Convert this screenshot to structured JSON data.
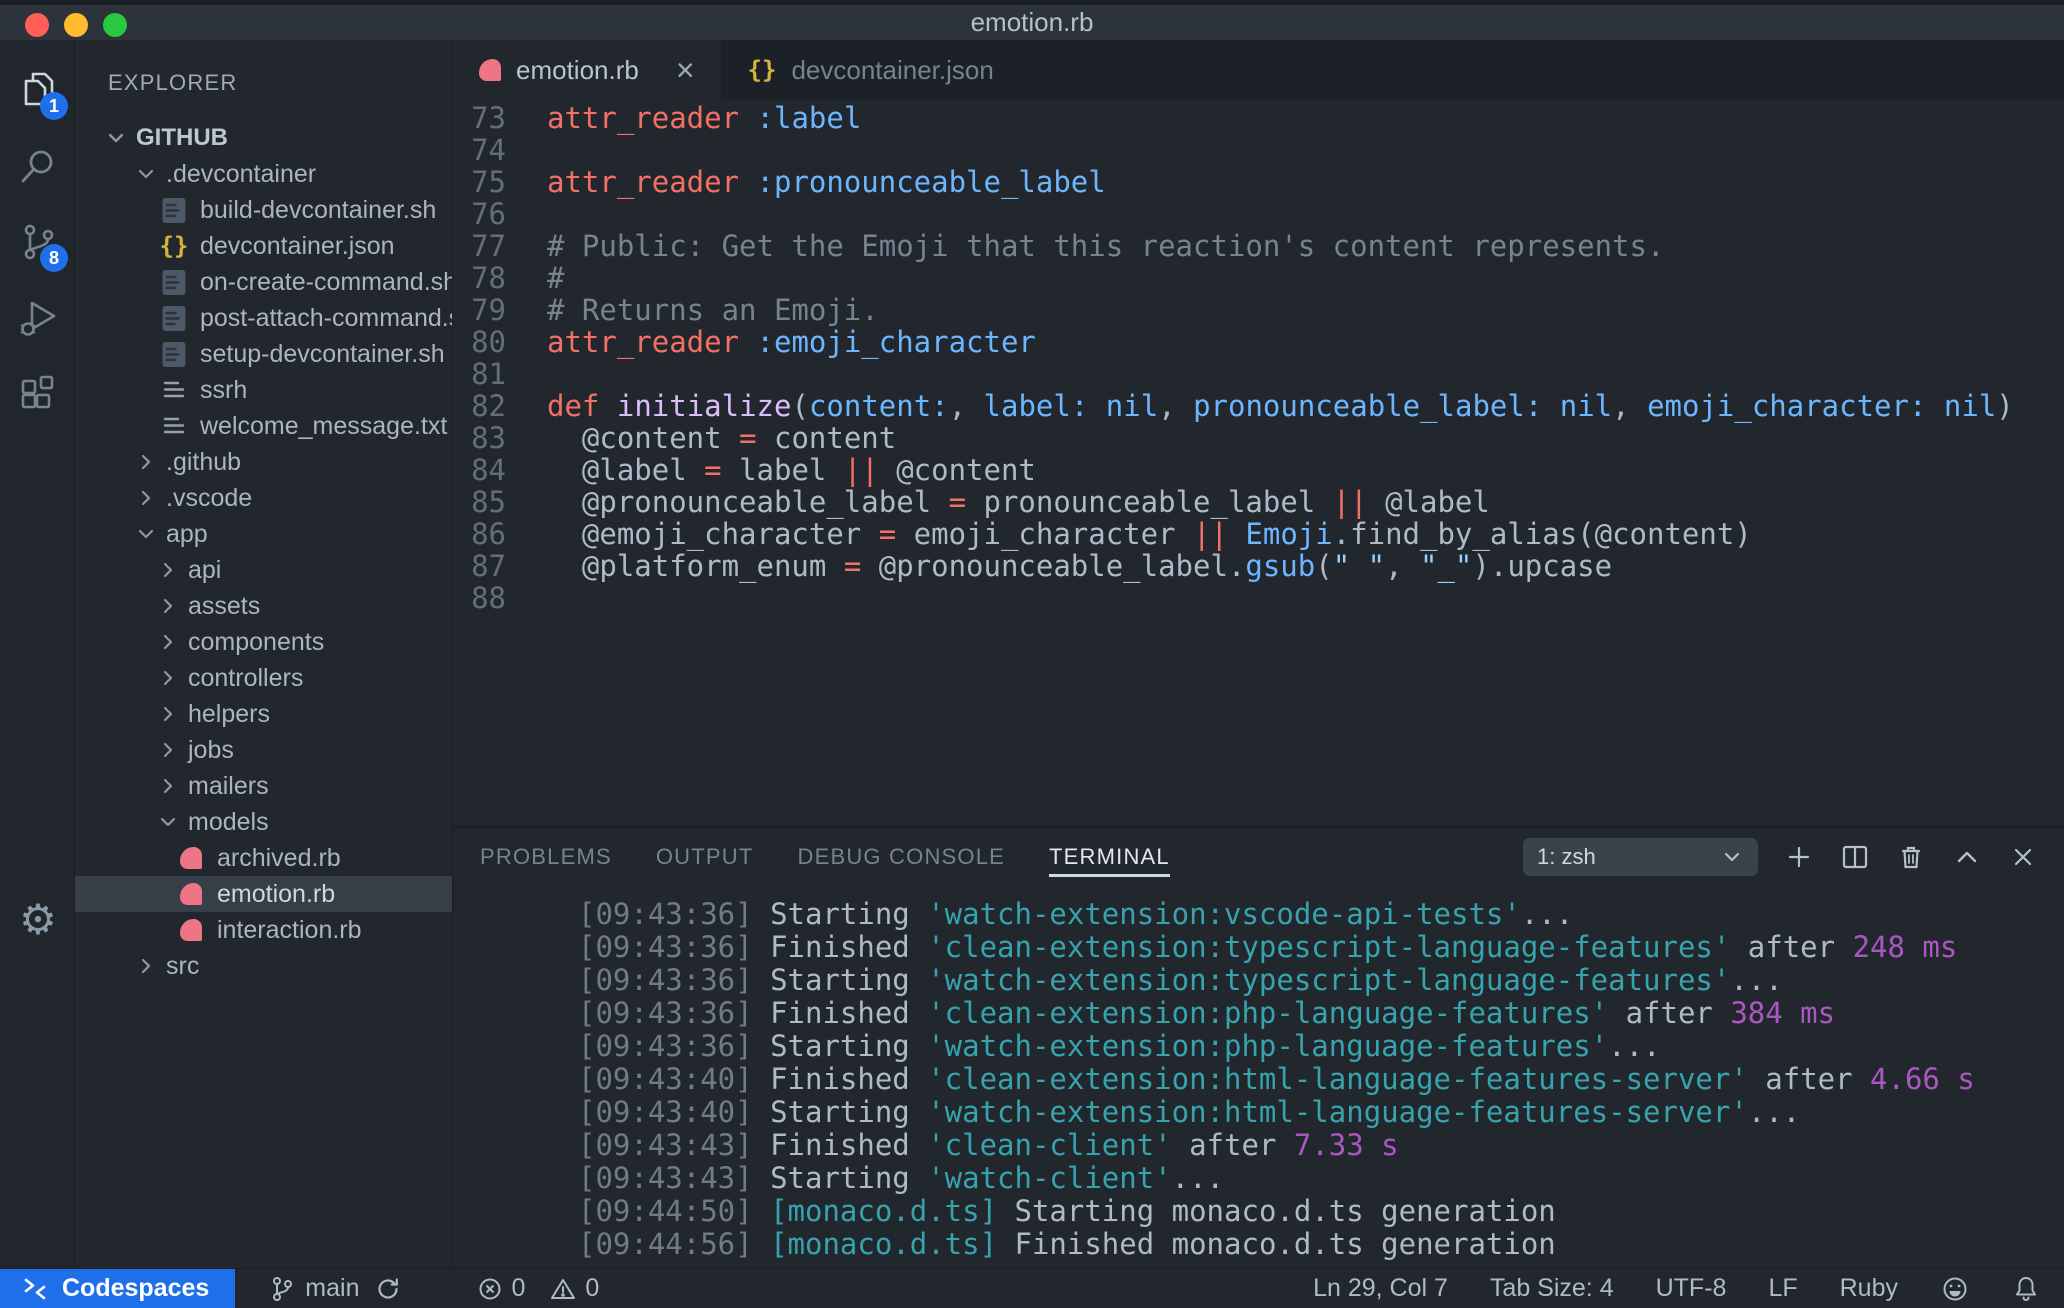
{
  "titlebar": {
    "title": "emotion.rb"
  },
  "activity_bar": {
    "explorer_badge": "1",
    "scm_badge": "8"
  },
  "sidebar": {
    "header": "EXPLORER",
    "section": "GITHUB",
    "tree": [
      {
        "label": ".devcontainer",
        "kind": "open",
        "icon": "none",
        "level": 1
      },
      {
        "label": "build-devcontainer.sh",
        "kind": "file",
        "icon": "script",
        "level": 2
      },
      {
        "label": "devcontainer.json",
        "kind": "file",
        "icon": "json",
        "level": 2
      },
      {
        "label": "on-create-command.sh",
        "kind": "file",
        "icon": "script",
        "level": 2
      },
      {
        "label": "post-attach-command.sh",
        "kind": "file",
        "icon": "script",
        "level": 2
      },
      {
        "label": "setup-devcontainer.sh",
        "kind": "file",
        "icon": "script",
        "level": 2
      },
      {
        "label": "ssrh",
        "kind": "file",
        "icon": "lines",
        "level": 2
      },
      {
        "label": "welcome_message.txt",
        "kind": "file",
        "icon": "lines",
        "level": 2
      },
      {
        "label": ".github",
        "kind": "closed",
        "icon": "none",
        "level": 1
      },
      {
        "label": ".vscode",
        "kind": "closed",
        "icon": "none",
        "level": 1
      },
      {
        "label": "app",
        "kind": "open",
        "icon": "none",
        "level": 1
      },
      {
        "label": "api",
        "kind": "closed",
        "icon": "none",
        "level": 2
      },
      {
        "label": "assets",
        "kind": "closed",
        "icon": "none",
        "level": 2
      },
      {
        "label": "components",
        "kind": "closed",
        "icon": "none",
        "level": 2
      },
      {
        "label": "controllers",
        "kind": "closed",
        "icon": "none",
        "level": 2
      },
      {
        "label": "helpers",
        "kind": "closed",
        "icon": "none",
        "level": 2
      },
      {
        "label": "jobs",
        "kind": "closed",
        "icon": "none",
        "level": 2
      },
      {
        "label": "mailers",
        "kind": "closed",
        "icon": "none",
        "level": 2
      },
      {
        "label": "models",
        "kind": "open",
        "icon": "none",
        "level": 2
      },
      {
        "label": "archived.rb",
        "kind": "file",
        "icon": "ruby",
        "level": 3
      },
      {
        "label": "emotion.rb",
        "kind": "file",
        "icon": "ruby",
        "level": 3,
        "selected": true
      },
      {
        "label": "interaction.rb",
        "kind": "file",
        "icon": "ruby",
        "level": 3
      },
      {
        "label": "src",
        "kind": "closed",
        "icon": "none",
        "level": 1
      }
    ]
  },
  "tabs": [
    {
      "label": "emotion.rb",
      "icon": "ruby",
      "close": "×",
      "active": true
    },
    {
      "label": "devcontainer.json",
      "icon": "json",
      "active": false
    }
  ],
  "icons": {
    "json_glyph": "{}"
  },
  "editor": {
    "lines": [
      {
        "num": "73",
        "segments": [
          {
            "t": "attr_reader",
            "c": "red"
          },
          {
            "t": " ",
            "c": "fg"
          },
          {
            "t": ":label",
            "c": "blue"
          }
        ]
      },
      {
        "num": "74",
        "segments": []
      },
      {
        "num": "75",
        "segments": [
          {
            "t": "attr_reader",
            "c": "red"
          },
          {
            "t": " ",
            "c": "fg"
          },
          {
            "t": ":pronounceable_label",
            "c": "blue"
          }
        ]
      },
      {
        "num": "76",
        "segments": []
      },
      {
        "num": "77",
        "segments": [
          {
            "t": "# Public: Get the Emoji that this reaction's content represents.",
            "c": "com"
          }
        ]
      },
      {
        "num": "78",
        "segments": [
          {
            "t": "#",
            "c": "com"
          }
        ]
      },
      {
        "num": "79",
        "segments": [
          {
            "t": "# Returns an Emoji.",
            "c": "com"
          }
        ]
      },
      {
        "num": "80",
        "segments": [
          {
            "t": "attr_reader",
            "c": "red"
          },
          {
            "t": " ",
            "c": "fg"
          },
          {
            "t": ":emoji_character",
            "c": "blue"
          }
        ]
      },
      {
        "num": "81",
        "segments": []
      },
      {
        "num": "82",
        "segments": [
          {
            "t": "def",
            "c": "red"
          },
          {
            "t": " ",
            "c": "fg"
          },
          {
            "t": "initialize",
            "c": "purple"
          },
          {
            "t": "(",
            "c": "fg"
          },
          {
            "t": "content:",
            "c": "blue"
          },
          {
            "t": ", ",
            "c": "fg"
          },
          {
            "t": "label:",
            "c": "blue"
          },
          {
            "t": " ",
            "c": "fg"
          },
          {
            "t": "nil",
            "c": "blue"
          },
          {
            "t": ", ",
            "c": "fg"
          },
          {
            "t": "pronounceable_label:",
            "c": "blue"
          },
          {
            "t": " ",
            "c": "fg"
          },
          {
            "t": "nil",
            "c": "blue"
          },
          {
            "t": ", ",
            "c": "fg"
          },
          {
            "t": "emoji_character:",
            "c": "blue"
          },
          {
            "t": " ",
            "c": "fg"
          },
          {
            "t": "nil",
            "c": "blue"
          },
          {
            "t": ")",
            "c": "fg"
          }
        ]
      },
      {
        "num": "83",
        "segments": [
          {
            "t": "  @content ",
            "c": "fg"
          },
          {
            "t": "=",
            "c": "red"
          },
          {
            "t": " content",
            "c": "fg"
          }
        ]
      },
      {
        "num": "84",
        "segments": [
          {
            "t": "  @label ",
            "c": "fg"
          },
          {
            "t": "=",
            "c": "red"
          },
          {
            "t": " label ",
            "c": "fg"
          },
          {
            "t": "||",
            "c": "red"
          },
          {
            "t": " @content",
            "c": "fg"
          }
        ]
      },
      {
        "num": "85",
        "segments": [
          {
            "t": "  @pronounceable_label ",
            "c": "fg"
          },
          {
            "t": "=",
            "c": "red"
          },
          {
            "t": " pronounceable_label ",
            "c": "fg"
          },
          {
            "t": "||",
            "c": "red"
          },
          {
            "t": " @label",
            "c": "fg"
          }
        ]
      },
      {
        "num": "86",
        "segments": [
          {
            "t": "  @emoji_character ",
            "c": "fg"
          },
          {
            "t": "=",
            "c": "red"
          },
          {
            "t": " emoji_character ",
            "c": "fg"
          },
          {
            "t": "||",
            "c": "red"
          },
          {
            "t": " ",
            "c": "fg"
          },
          {
            "t": "Emoji",
            "c": "blue"
          },
          {
            "t": ".find_by_alias(@content)",
            "c": "fg"
          }
        ]
      },
      {
        "num": "87",
        "segments": [
          {
            "t": "  @platform_enum ",
            "c": "fg"
          },
          {
            "t": "=",
            "c": "red"
          },
          {
            "t": " @pronounceable_label.",
            "c": "fg"
          },
          {
            "t": "gsub",
            "c": "blue"
          },
          {
            "t": "(",
            "c": "fg"
          },
          {
            "t": "\" \"",
            "c": "str"
          },
          {
            "t": ", ",
            "c": "fg"
          },
          {
            "t": "\"_\"",
            "c": "str"
          },
          {
            "t": ").upcase",
            "c": "fg"
          }
        ]
      },
      {
        "num": "88",
        "segments": []
      }
    ]
  },
  "panel": {
    "tabs": [
      {
        "label": "PROBLEMS",
        "active": false
      },
      {
        "label": "OUTPUT",
        "active": false
      },
      {
        "label": "DEBUG CONSOLE",
        "active": false
      },
      {
        "label": "TERMINAL",
        "active": true
      }
    ],
    "terminal_select": "1: zsh",
    "terminal_lines": [
      {
        "segments": [
          {
            "t": "[09:43:36] ",
            "c": "dim"
          },
          {
            "t": "Starting ",
            "c": "tfg"
          },
          {
            "t": "'watch-extension:vscode-api-tests'",
            "c": "teal"
          },
          {
            "t": "...",
            "c": "tfg"
          }
        ]
      },
      {
        "segments": [
          {
            "t": "[09:43:36] ",
            "c": "dim"
          },
          {
            "t": "Finished ",
            "c": "tfg"
          },
          {
            "t": "'clean-extension:typescript-language-features'",
            "c": "teal"
          },
          {
            "t": " after ",
            "c": "tfg"
          },
          {
            "t": "248 ms",
            "c": "mag"
          }
        ]
      },
      {
        "segments": [
          {
            "t": "[09:43:36] ",
            "c": "dim"
          },
          {
            "t": "Starting ",
            "c": "tfg"
          },
          {
            "t": "'watch-extension:typescript-language-features'",
            "c": "teal"
          },
          {
            "t": "...",
            "c": "tfg"
          }
        ]
      },
      {
        "segments": [
          {
            "t": "[09:43:36] ",
            "c": "dim"
          },
          {
            "t": "Finished ",
            "c": "tfg"
          },
          {
            "t": "'clean-extension:php-language-features'",
            "c": "teal"
          },
          {
            "t": " after ",
            "c": "tfg"
          },
          {
            "t": "384 ms",
            "c": "mag"
          }
        ]
      },
      {
        "segments": [
          {
            "t": "[09:43:36] ",
            "c": "dim"
          },
          {
            "t": "Starting ",
            "c": "tfg"
          },
          {
            "t": "'watch-extension:php-language-features'",
            "c": "teal"
          },
          {
            "t": "...",
            "c": "tfg"
          }
        ]
      },
      {
        "segments": [
          {
            "t": "[09:43:40] ",
            "c": "dim"
          },
          {
            "t": "Finished ",
            "c": "tfg"
          },
          {
            "t": "'clean-extension:html-language-features-server'",
            "c": "teal"
          },
          {
            "t": " after ",
            "c": "tfg"
          },
          {
            "t": "4.66 s",
            "c": "mag"
          }
        ]
      },
      {
        "segments": [
          {
            "t": "[09:43:40] ",
            "c": "dim"
          },
          {
            "t": "Starting ",
            "c": "tfg"
          },
          {
            "t": "'watch-extension:html-language-features-server'",
            "c": "teal"
          },
          {
            "t": "...",
            "c": "tfg"
          }
        ]
      },
      {
        "segments": [
          {
            "t": "[09:43:43] ",
            "c": "dim"
          },
          {
            "t": "Finished ",
            "c": "tfg"
          },
          {
            "t": "'clean-client'",
            "c": "teal"
          },
          {
            "t": " after ",
            "c": "tfg"
          },
          {
            "t": "7.33 s",
            "c": "mag"
          }
        ]
      },
      {
        "segments": [
          {
            "t": "[09:43:43] ",
            "c": "dim"
          },
          {
            "t": "Starting ",
            "c": "tfg"
          },
          {
            "t": "'watch-client'",
            "c": "teal"
          },
          {
            "t": "...",
            "c": "tfg"
          }
        ]
      },
      {
        "segments": [
          {
            "t": "[09:44:50] ",
            "c": "dim"
          },
          {
            "t": "[monaco.d.ts]",
            "c": "teal"
          },
          {
            "t": " Starting monaco.d.ts generation",
            "c": "tfg"
          }
        ]
      },
      {
        "segments": [
          {
            "t": "[09:44:56] ",
            "c": "dim"
          },
          {
            "t": "[monaco.d.ts]",
            "c": "teal"
          },
          {
            "t": " Finished monaco.d.ts generation",
            "c": "tfg"
          }
        ]
      }
    ]
  },
  "statusbar": {
    "remote_label": "Codespaces",
    "branch": "main",
    "errors": "0",
    "warnings": "0",
    "ln_col": "Ln 29, Col 7",
    "tab_size": "Tab Size: 4",
    "encoding": "UTF-8",
    "eol": "LF",
    "language": "Ruby"
  },
  "colors": {
    "accent_blue": "#1f6feb",
    "ruby_pink": "#ee7585",
    "json_yellow": "#d4b43f",
    "keyword_red": "#f47067",
    "symbol_blue": "#6cb6ff",
    "function_purple": "#dcbdfb",
    "string_blue": "#96d0ff",
    "comment_gray": "#768390",
    "terminal_teal": "#36a3ad",
    "terminal_magenta": "#ab57c2"
  }
}
